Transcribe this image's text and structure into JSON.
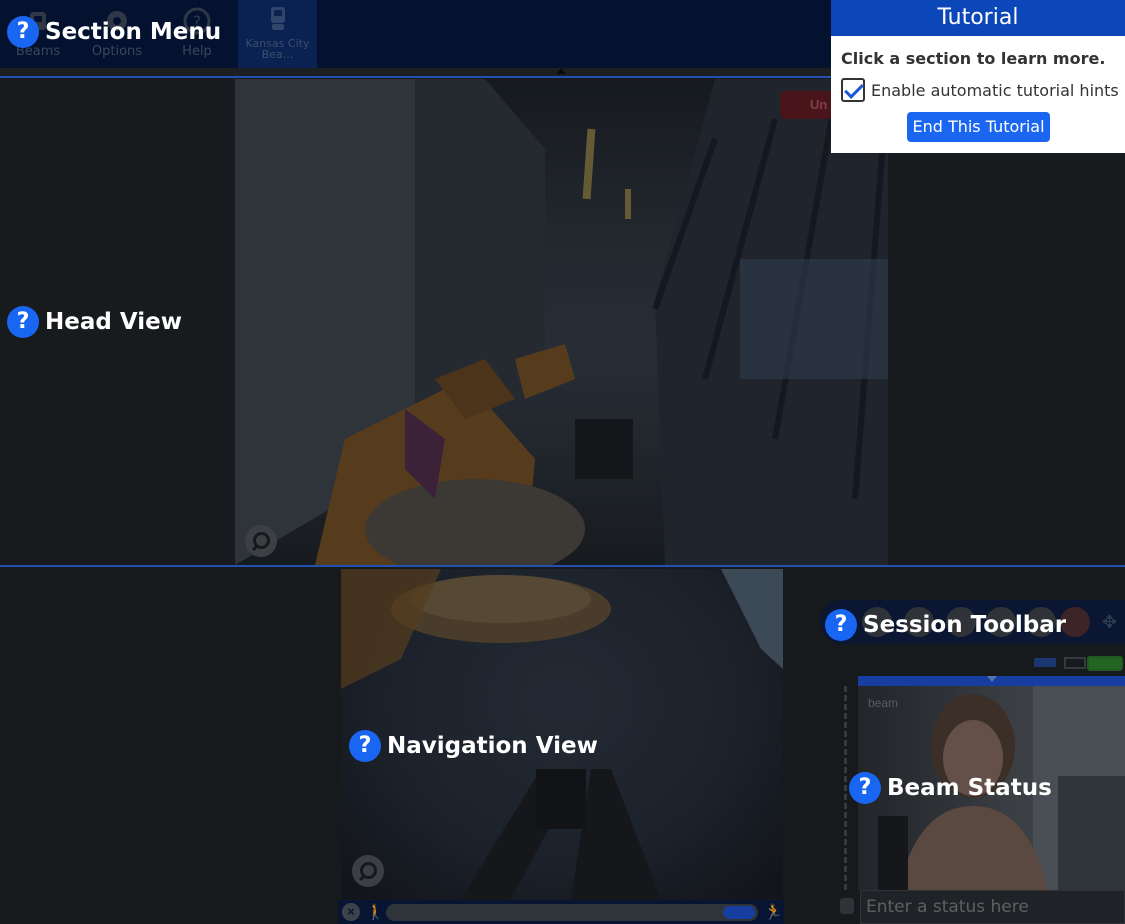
{
  "menu": {
    "items": [
      {
        "label": "Beams",
        "icon": "beams-icon"
      },
      {
        "label": "Options",
        "icon": "gear-icon"
      },
      {
        "label": "Help",
        "icon": "help-icon"
      }
    ],
    "active_beam": {
      "label": "Kansas City Bea...",
      "icon": "beam-robot-icon"
    }
  },
  "head_view": {
    "mute_label": "Un"
  },
  "nav_view": {},
  "beam_status": {
    "camera_label": "beam",
    "status_placeholder": "Enter a status here"
  },
  "hints": {
    "section_menu": "Section Menu",
    "head_view": "Head View",
    "navigation_view": "Navigation View",
    "session_toolbar": "Session Toolbar",
    "beam_status": "Beam Status",
    "marker": "?"
  },
  "tutorial": {
    "title": "Tutorial",
    "subtitle": "Click a section to learn more.",
    "checkbox_label": "Enable automatic tutorial hints",
    "checkbox_checked": true,
    "end_button": "End This Tutorial"
  },
  "colors": {
    "accent": "#1866f2",
    "menu_bg": "#06153a",
    "tutorial_header": "#0b47b8"
  }
}
